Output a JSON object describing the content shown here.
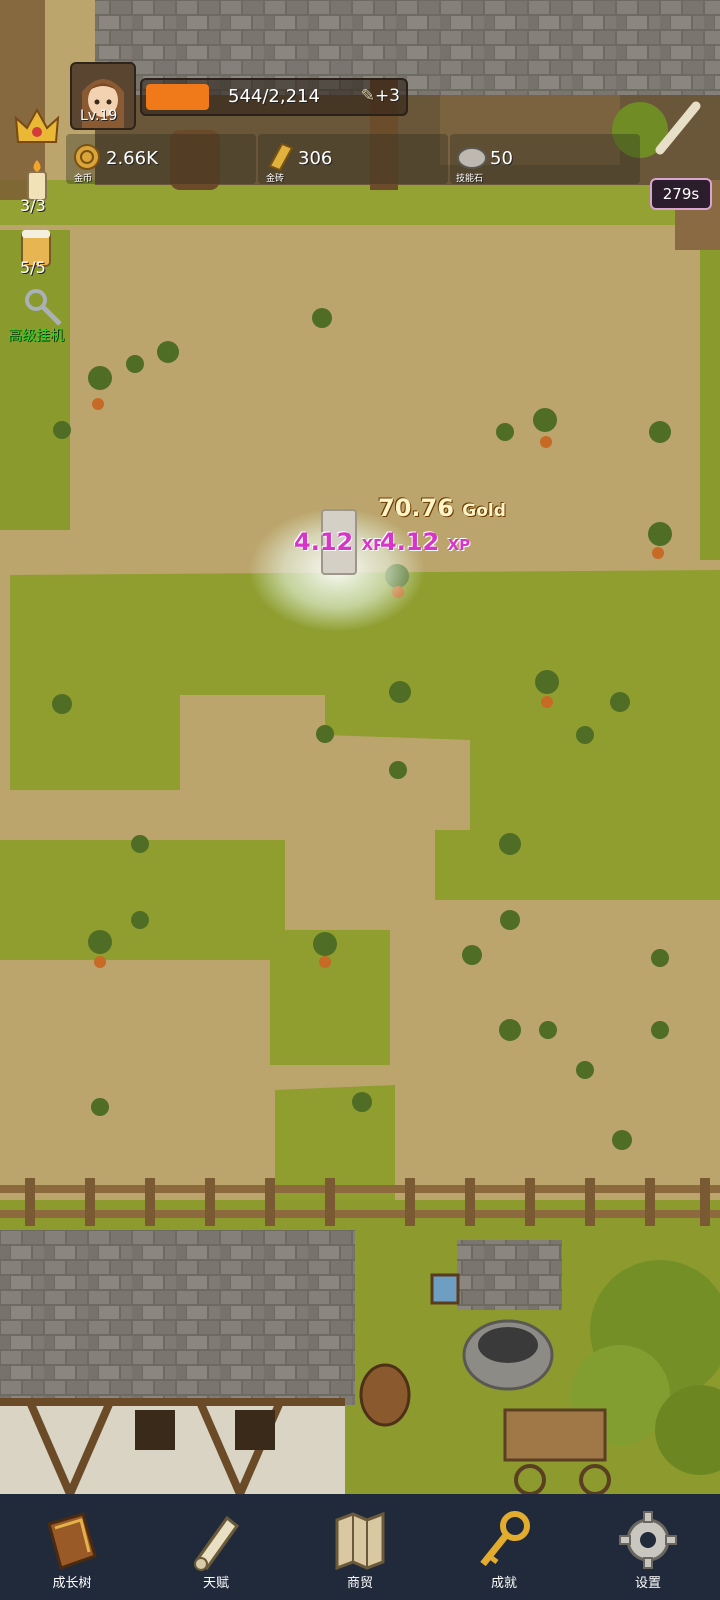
{
  "hud": {
    "level": "Lv.19",
    "xp_text": "544/2,214",
    "xp_fraction": 0.2457,
    "xp_bonus": "+3",
    "resources": [
      {
        "icon": "gold-coin-icon",
        "value": "2.66K",
        "label": "金币"
      },
      {
        "icon": "gold-bar-icon",
        "value": "306",
        "label": "金砖"
      },
      {
        "icon": "skill-stone-icon",
        "value": "50",
        "label": "技能石"
      }
    ],
    "side": {
      "candle_count": "3/3",
      "beer_count": "5/5",
      "auto_idle_label": "高级挂机"
    },
    "timer": "279s"
  },
  "floats": {
    "gold_value": "70.76",
    "gold_unit": "Gold",
    "xp_values": [
      {
        "value": "4.12",
        "unit": "XP"
      },
      {
        "value": "4.12",
        "unit": "XP"
      }
    ]
  },
  "nav": [
    {
      "label": "成长树",
      "icon": "book-icon"
    },
    {
      "label": "天赋",
      "icon": "scroll-icon"
    },
    {
      "label": "商贸",
      "icon": "map-icon"
    },
    {
      "label": "成就",
      "icon": "key-icon"
    },
    {
      "label": "设置",
      "icon": "gear-icon"
    }
  ],
  "colors": {
    "xp_fill": "#f07a19",
    "xp_float": "#d735c8",
    "auto_idle": "#27d827",
    "nav_bg": "#212a3b"
  }
}
